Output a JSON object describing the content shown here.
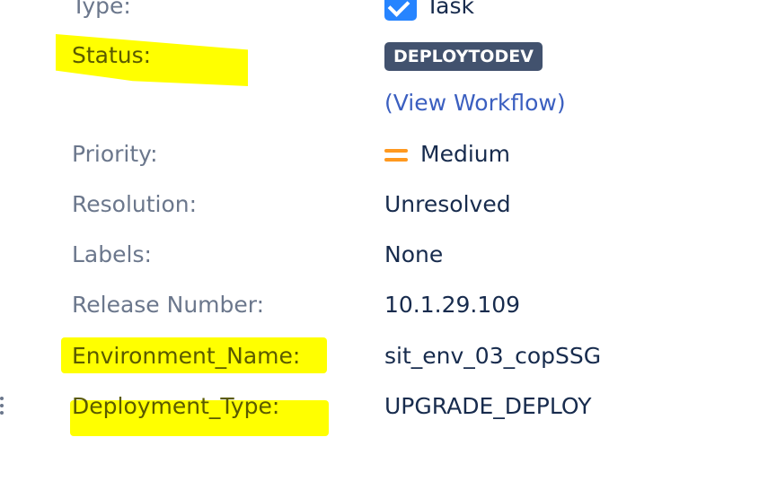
{
  "fields": {
    "type": {
      "label": "Type:",
      "value": "Task",
      "icon": "task-checkbox-icon"
    },
    "status": {
      "label": "Status:",
      "value": "DEPLOYTODEV",
      "link": "(View Workflow)"
    },
    "priority": {
      "label": "Priority:",
      "value": "Medium",
      "icon": "priority-medium-icon",
      "icon_color": "#ff991f"
    },
    "resolution": {
      "label": "Resolution:",
      "value": "Unresolved"
    },
    "labels": {
      "label": "Labels:",
      "value": "None"
    },
    "release_number": {
      "label": "Release Number:",
      "value": "10.1.29.109"
    },
    "environment_name": {
      "label": "Environment_Name:",
      "value": "sit_env_03_copSSG"
    },
    "deployment_type": {
      "label": "Deployment_Type:",
      "value": "UPGRADE_DEPLOY"
    }
  },
  "colors": {
    "highlight": "#ffff00",
    "status_badge": "#42526e",
    "link": "#3b5fc0"
  }
}
